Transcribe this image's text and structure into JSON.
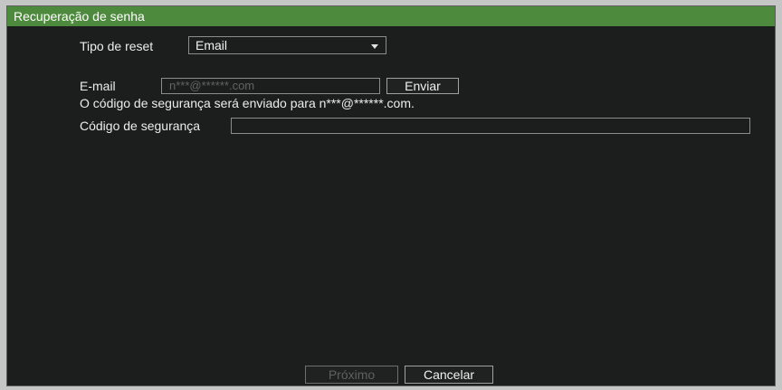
{
  "dialog": {
    "title": "Recuperação de senha"
  },
  "form": {
    "reset_type": {
      "label": "Tipo de reset",
      "value": "Email",
      "icon": "chevron-down-icon"
    },
    "email": {
      "label": "E-mail",
      "value": "n***@******.com",
      "send_label": "Enviar"
    },
    "notice": "O código de segurança será enviado para n***@******.com.",
    "security_code": {
      "label": "Código de segurança"
    }
  },
  "footer": {
    "next_label": "Próximo",
    "next_enabled": false,
    "cancel_label": "Cancelar"
  },
  "colors": {
    "title_bar": "#4e8a3e",
    "panel_bg": "#1c1e1d"
  }
}
